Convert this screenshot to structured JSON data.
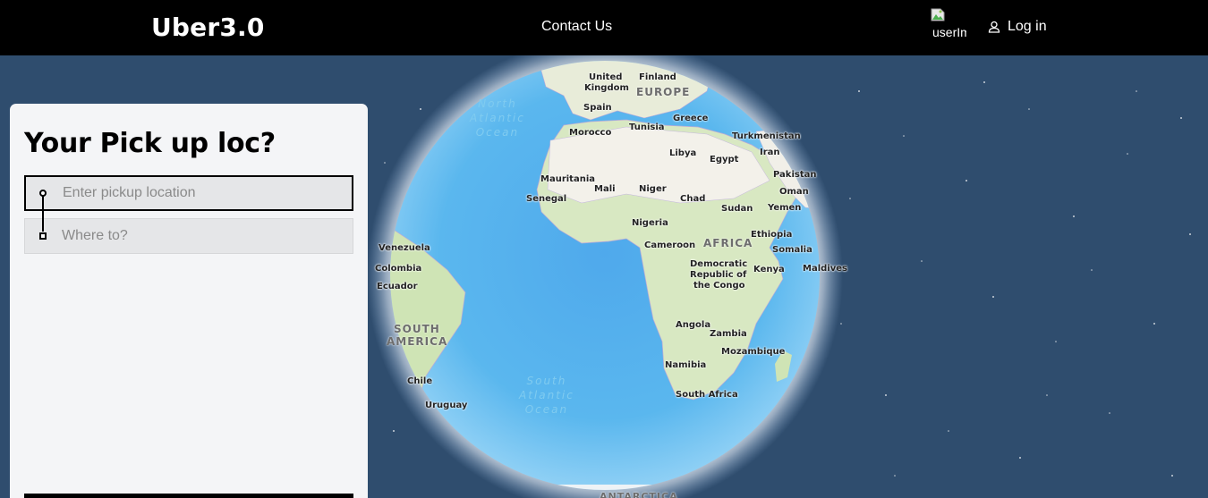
{
  "header": {
    "logo": "Uber3.0",
    "contact": "Contact Us",
    "avatar_alt": "userIm",
    "login": "Log in"
  },
  "panel": {
    "title": "Your Pick up loc?",
    "pickup_placeholder": "Enter pickup location",
    "destination_placeholder": "Where to?"
  },
  "map": {
    "oceans": {
      "north_atlantic": [
        "North",
        "Atlantic",
        "Ocean"
      ],
      "south_atlantic": [
        "South",
        "Atlantic",
        "Ocean"
      ]
    },
    "regions": {
      "europe": "EUROPE",
      "africa": "AFRICA",
      "south_america_1": "SOUTH",
      "south_america_2": "AMERICA",
      "antarctica": "ANTARCTICA"
    },
    "countries": {
      "uk_1": "United",
      "uk_2": "Kingdom",
      "finland": "Finland",
      "spain": "Spain",
      "greece": "Greece",
      "morocco": "Morocco",
      "tunisia": "Tunisia",
      "turkmenistan": "Turkmenistan",
      "libya": "Libya",
      "egypt": "Egypt",
      "iran": "Iran",
      "pakistan": "Pakistan",
      "mauritania": "Mauritania",
      "mali": "Mali",
      "niger": "Niger",
      "oman": "Oman",
      "senegal": "Senegal",
      "chad": "Chad",
      "sudan": "Sudan",
      "yemen": "Yemen",
      "nigeria": "Nigeria",
      "ethiopia": "Ethiopia",
      "venezuela": "Venezuela",
      "cameroon": "Cameroon",
      "somalia": "Somalia",
      "colombia": "Colombia",
      "drc_1": "Democratic",
      "drc_2": "Republic of",
      "drc_3": "the Congo",
      "kenya": "Kenya",
      "maldives": "Maldives",
      "ecuador": "Ecuador",
      "angola": "Angola",
      "zambia": "Zambia",
      "mozambique": "Mozambique",
      "namibia": "Namibia",
      "chile": "Chile",
      "south_africa": "South Africa",
      "uruguay": "Uruguay"
    }
  },
  "colors": {
    "header_bg": "#000000",
    "space_bg": "#2f4d6e",
    "ocean": "#5ab4ec",
    "land": "#cde4b8",
    "panel_bg": "#f4f5f7"
  }
}
